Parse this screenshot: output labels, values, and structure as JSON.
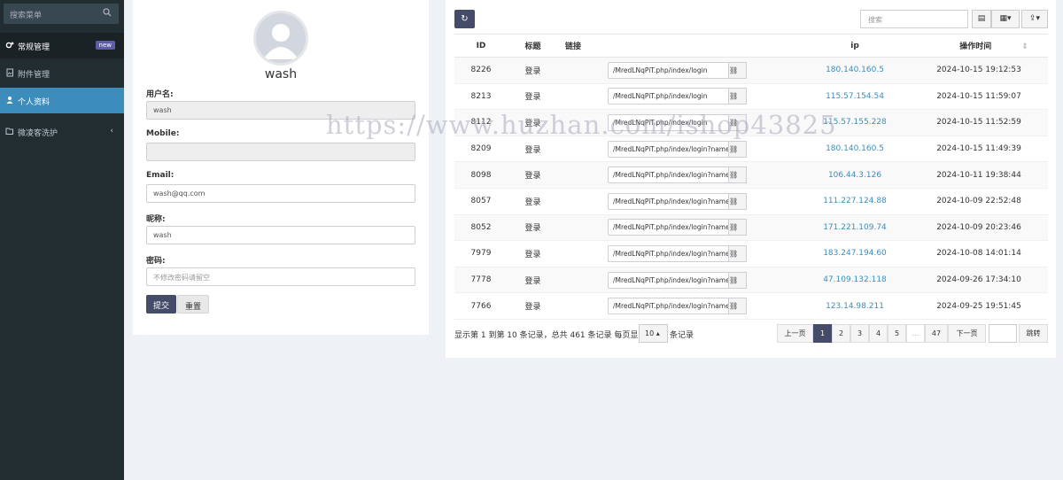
{
  "sidebar": {
    "search_placeholder": "搜索菜单",
    "items": [
      {
        "label": "常规管理",
        "badge": "new"
      },
      {
        "label": "附件管理"
      },
      {
        "label": "个人资料"
      },
      {
        "label": "微凌客洗护"
      }
    ]
  },
  "profile": {
    "username_display": "wash",
    "fields": [
      {
        "label": "用户名:",
        "value": "wash",
        "placeholder": ""
      },
      {
        "label": "Mobile:",
        "value": "",
        "placeholder": ""
      },
      {
        "label": "Email:",
        "value": "wash@qq.com",
        "placeholder": ""
      },
      {
        "label": "昵称:",
        "value": "wash",
        "placeholder": ""
      },
      {
        "label": "密码:",
        "value": "",
        "placeholder": "不修改密码请留空"
      }
    ],
    "submit_label": "提交",
    "reset_label": "重置"
  },
  "log_table": {
    "search_placeholder": "搜索",
    "columns": [
      "ID",
      "标题",
      "链接",
      "ip",
      "操作时间"
    ],
    "rows": [
      {
        "id": "8226",
        "title": "登录",
        "url": "/MredLNqPiT.php/index/login",
        "ip": "180.140.160.5",
        "time": "2024-10-15 19:12:53"
      },
      {
        "id": "8213",
        "title": "登录",
        "url": "/MredLNqPiT.php/index/login",
        "ip": "115.57.154.54",
        "time": "2024-10-15 11:59:07"
      },
      {
        "id": "8112",
        "title": "登录",
        "url": "/MredLNqPiT.php/index/login",
        "ip": "115.57.155.228",
        "time": "2024-10-15 11:52:59"
      },
      {
        "id": "8209",
        "title": "登录",
        "url": "/MredLNqPiT.php/index/login?name=",
        "ip": "180.140.160.5",
        "time": "2024-10-15 11:49:39"
      },
      {
        "id": "8098",
        "title": "登录",
        "url": "/MredLNqPiT.php/index/login?name=",
        "ip": "106.44.3.126",
        "time": "2024-10-11 19:38:44"
      },
      {
        "id": "8057",
        "title": "登录",
        "url": "/MredLNqPiT.php/index/login?name=",
        "ip": "111.227.124.88",
        "time": "2024-10-09 22:52:48"
      },
      {
        "id": "8052",
        "title": "登录",
        "url": "/MredLNqPiT.php/index/login?name=",
        "ip": "171.221.109.74",
        "time": "2024-10-09 20:23:46"
      },
      {
        "id": "7979",
        "title": "登录",
        "url": "/MredLNqPiT.php/index/login?name=",
        "ip": "183.247.194.60",
        "time": "2024-10-08 14:01:14"
      },
      {
        "id": "7778",
        "title": "登录",
        "url": "/MredLNqPiT.php/index/login?name=",
        "ip": "47.109.132.118",
        "time": "2024-09-26 17:34:10"
      },
      {
        "id": "7766",
        "title": "登录",
        "url": "/MredLNqPiT.php/index/login?name=",
        "ip": "123.14.98.211",
        "time": "2024-09-25 19:51:45"
      }
    ],
    "footer_prefix": "显示第 1 到第 10 条记录，总共 461 条记录 每页显示",
    "page_size": "10",
    "footer_suffix": "条记录",
    "pagination": {
      "prev": "上一页",
      "pages": [
        "1",
        "2",
        "3",
        "4",
        "5",
        "...",
        "47"
      ],
      "next": "下一页",
      "goto": "跳转"
    }
  },
  "watermark": "https://www.huzhan.com/ishop43825"
}
